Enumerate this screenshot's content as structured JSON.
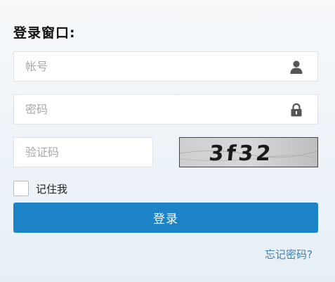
{
  "login": {
    "title": "登录窗口:",
    "username": {
      "placeholder": "帐号",
      "value": ""
    },
    "password": {
      "placeholder": "密码",
      "value": ""
    },
    "captcha": {
      "placeholder": "验证码",
      "value": "",
      "image_text": "3f32"
    },
    "remember_label": "记住我",
    "remember_checked": false,
    "submit_label": "登录",
    "forgot_password_label": "忘记密码?"
  },
  "icons": {
    "username": "user-icon",
    "password": "lock-icon"
  },
  "colors": {
    "primary_button": "#1d83c7",
    "link": "#3f7fae",
    "field_border": "#dfe3e8",
    "placeholder": "#a9a9a9"
  }
}
